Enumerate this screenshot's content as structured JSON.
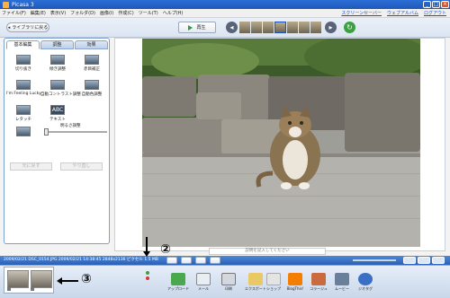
{
  "titlebar": {
    "title": "Picasa 3"
  },
  "menu": {
    "items": [
      "ファイル(F)",
      "編集(E)",
      "表示(V)",
      "フォルダ(D)",
      "画像(I)",
      "作成(C)",
      "ツール(T)",
      "ヘルプ(H)"
    ],
    "links": [
      "スクリーンセーバー",
      "ウェブアルバム",
      "ログアウト"
    ]
  },
  "toolbar": {
    "back_label": "ライブラリに戻る",
    "play_label": "再生"
  },
  "panel": {
    "tabs": [
      "基本編集",
      "調整",
      "効果"
    ],
    "tools": [
      "切り抜き",
      "傾き調整",
      "赤目補正",
      "I'm Feeling Lucky",
      "自動コントラスト調整",
      "自動色調整",
      "レタッチ",
      "テキスト",
      "明るさ調整"
    ],
    "undo_label": "元に戻す",
    "redo_label": "やり直し"
  },
  "caption": {
    "placeholder": "説明を記入してください"
  },
  "status": {
    "text": "2009/02/21 DSC_0154.JPG   2009/02/21 14:38:45   2848x2136 ピクセル   1.5 MB"
  },
  "share": {
    "labels": [
      "アップロード",
      "メール",
      "印刷",
      "エクスポート",
      "ショップ",
      "BlogThis!",
      "コラージュ",
      "ムービー",
      "ジオタグ"
    ]
  },
  "annotations": {
    "two": "②",
    "three": "③"
  }
}
